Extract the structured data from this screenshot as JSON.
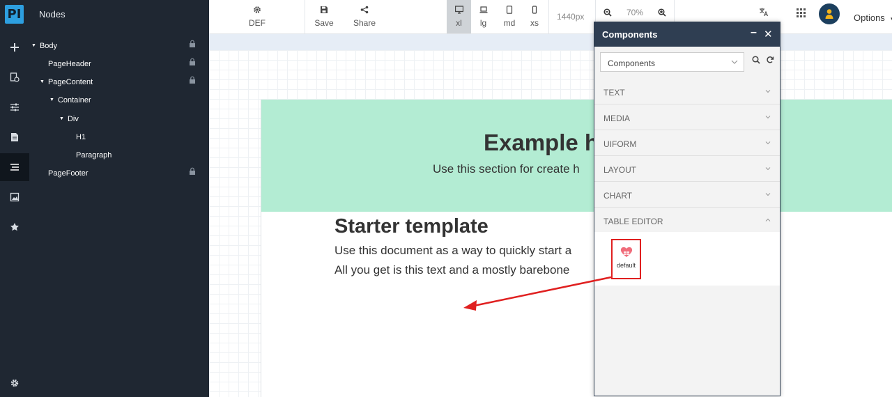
{
  "logo_text": "PI",
  "nodes": {
    "title": "Nodes",
    "tree": [
      {
        "label": "Body"
      },
      {
        "label": "PageHeader"
      },
      {
        "label": "PageContent"
      },
      {
        "label": "Container"
      },
      {
        "label": "Div"
      },
      {
        "label": "H1"
      },
      {
        "label": "Paragraph"
      },
      {
        "label": "PageFooter"
      }
    ]
  },
  "toolbar": {
    "def_label": "DEF",
    "save_label": "Save",
    "share_label": "Share",
    "devices": [
      {
        "label": "xl",
        "active": true
      },
      {
        "label": "lg",
        "active": false
      },
      {
        "label": "md",
        "active": false
      },
      {
        "label": "xs",
        "active": false
      }
    ],
    "width_readout": "1440px",
    "zoom_readout": "70%",
    "options_label": "Options"
  },
  "canvas": {
    "hero_title": "Example h",
    "hero_subtitle": "Use this section for create h",
    "starter_title": "Starter template",
    "starter_line1": "Use this document as a way to quickly start a",
    "starter_line2": "All you get is this text and a mostly barebone"
  },
  "components_panel": {
    "title": "Components",
    "select_value": "Components",
    "sections": [
      {
        "label": "TEXT",
        "expanded": false
      },
      {
        "label": "MEDIA",
        "expanded": false
      },
      {
        "label": "UIFORM",
        "expanded": false
      },
      {
        "label": "LAYOUT",
        "expanded": false
      },
      {
        "label": "CHART",
        "expanded": false
      },
      {
        "label": "TABLE EDITOR",
        "expanded": true
      }
    ],
    "item_label": "default"
  },
  "colors": {
    "sidebar_bg": "#1f2732",
    "panel_header": "#2f3e52",
    "hero_bg": "#b3ecd3",
    "accent_logo": "#2d9fe0",
    "highlight": "#e02020"
  }
}
